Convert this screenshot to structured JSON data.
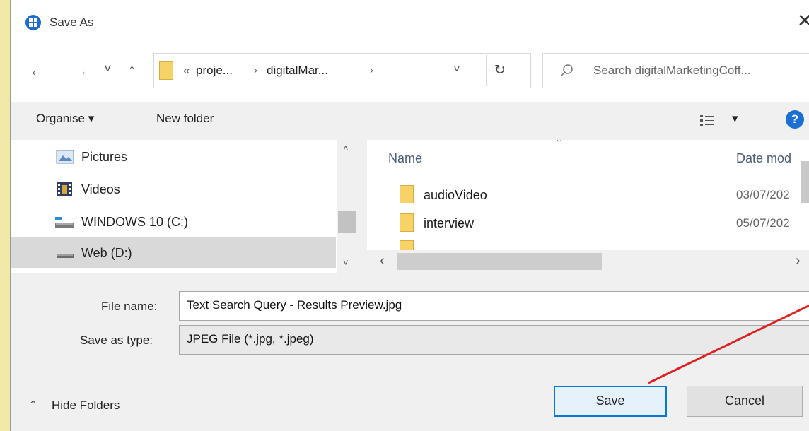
{
  "window": {
    "title": "Save As",
    "close_glyph": "✕"
  },
  "nav_buttons": {
    "back": "←",
    "forward": "→",
    "recent": "˅",
    "up": "↑"
  },
  "address": {
    "prefix": "«",
    "crumbs": [
      "proje...",
      "digitalMar..."
    ],
    "separator": "›",
    "dropdown": "˅",
    "refresh": "↻"
  },
  "search": {
    "placeholder": "Search digitalMarketingCoff..."
  },
  "toolbar": {
    "organise": "Organise ▾",
    "new_folder": "New folder",
    "view_dropdown": "▾",
    "help": "?"
  },
  "nav_pane": {
    "items": [
      {
        "label": "Pictures",
        "icon": "pictures-icon"
      },
      {
        "label": "Videos",
        "icon": "videos-icon"
      },
      {
        "label": "WINDOWS 10 (C:)",
        "icon": "drive-icon"
      },
      {
        "label": "Web (D:)",
        "icon": "drive-icon",
        "selected": true
      }
    ],
    "scroll_up": "˄",
    "scroll_down": "˅"
  },
  "file_list": {
    "sort_indicator": "^",
    "columns": {
      "name": "Name",
      "date": "Date mod"
    },
    "rows": [
      {
        "name": "audioVideo",
        "date": "03/07/202"
      },
      {
        "name": "interview",
        "date": "05/07/202"
      }
    ],
    "scroll_left": "‹",
    "scroll_right": "›"
  },
  "bottom": {
    "file_name_label": "File name:",
    "file_name_value": "Text Search Query - Results Preview.jpg",
    "save_type_label": "Save as type:",
    "save_type_value": "JPEG File (*.jpg, *.jpeg)",
    "hide_folders": "Hide Folders",
    "save": "Save",
    "cancel": "Cancel"
  },
  "colors": {
    "accent": "#0a78d7",
    "annotation": "#e02020",
    "folder": "#f7d266"
  }
}
